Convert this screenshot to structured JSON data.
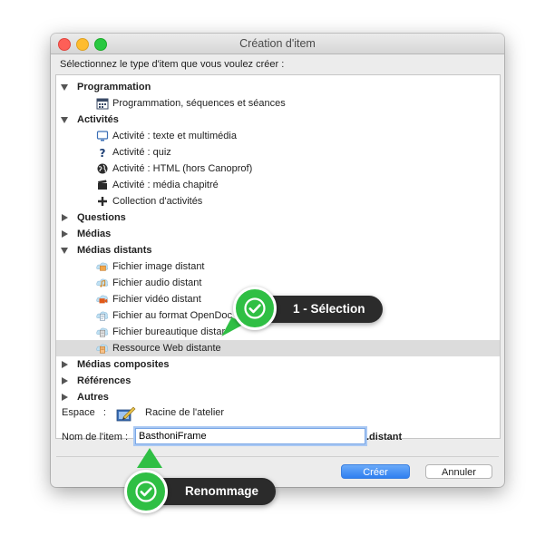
{
  "window": {
    "title": "Création d'item"
  },
  "prompt": "Sélectionnez le type d'item que vous voulez créer :",
  "tree": [
    {
      "kind": "category",
      "label": "Programmation",
      "open": true
    },
    {
      "kind": "item",
      "label": "Programmation, séquences et séances",
      "icon": "calendar-icon"
    },
    {
      "kind": "category",
      "label": "Activités",
      "open": true
    },
    {
      "kind": "item",
      "label": "Activité : texte et multimédia",
      "icon": "monitor-icon"
    },
    {
      "kind": "item",
      "label": "Activité : quiz",
      "icon": "question-icon"
    },
    {
      "kind": "item",
      "label": "Activité : HTML (hors Canoprof)",
      "icon": "globe-icon"
    },
    {
      "kind": "item",
      "label": "Activité : média chapitré",
      "icon": "clapper-icon"
    },
    {
      "kind": "item",
      "label": "Collection d'activités",
      "icon": "plus-icon"
    },
    {
      "kind": "category",
      "label": "Questions",
      "open": false
    },
    {
      "kind": "category",
      "label": "Médias",
      "open": false
    },
    {
      "kind": "category",
      "label": "Médias distants",
      "open": true
    },
    {
      "kind": "item",
      "label": "Fichier image distant",
      "icon": "remote-image-icon"
    },
    {
      "kind": "item",
      "label": "Fichier audio distant",
      "icon": "remote-audio-icon"
    },
    {
      "kind": "item",
      "label": "Fichier vidéo distant",
      "icon": "remote-video-icon"
    },
    {
      "kind": "item",
      "label": "Fichier au format OpenDoc",
      "icon": "remote-opendoc-icon"
    },
    {
      "kind": "item",
      "label": "Fichier bureautique distar",
      "icon": "remote-office-icon"
    },
    {
      "kind": "item",
      "label": "Ressource Web distante",
      "icon": "remote-web-icon",
      "selected": true
    },
    {
      "kind": "category",
      "label": "Médias composites",
      "open": false
    },
    {
      "kind": "category",
      "label": "Références",
      "open": false
    },
    {
      "kind": "category",
      "label": "Autres",
      "open": false
    }
  ],
  "espace": {
    "label": "Espace",
    "separator": ":",
    "value": "Racine de l'atelier",
    "icon": "workshop-icon"
  },
  "nom": {
    "label": "Nom de l'item :",
    "value": "BasthoniFrame",
    "extension": ".distant"
  },
  "buttons": {
    "create": "Créer",
    "cancel": "Annuler"
  },
  "callouts": {
    "selection": "1 - Sélection",
    "rename": "Renommage"
  },
  "colors": {
    "accent": "#2f7ff0",
    "badge": "#2fbf44",
    "callout": "#2b2b2b"
  }
}
